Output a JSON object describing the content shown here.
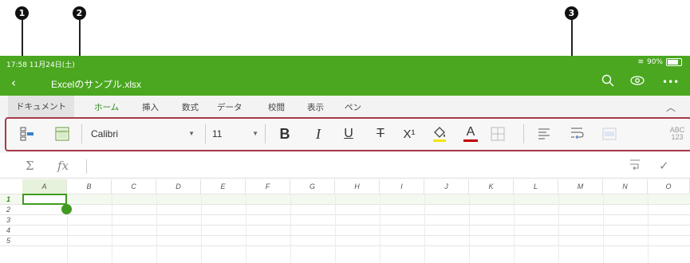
{
  "callouts": [
    "1",
    "2",
    "3"
  ],
  "statusbar": {
    "time": "17:58  11月24日(土)",
    "battery": "90%"
  },
  "titlebar": {
    "back": "‹",
    "title": "Excelのサンプル.xlsx",
    "icons": [
      "search-icon",
      "eye-icon",
      "more-icon"
    ]
  },
  "tabs": [
    "ドキュメント",
    "ホーム",
    "挿入",
    "数式",
    "データ",
    "校閲",
    "表示",
    "ペン"
  ],
  "ribbon": {
    "font": "Calibri",
    "size": "11",
    "bold": "B",
    "italic": "I",
    "underline": "U",
    "strike": "T",
    "superscript": "X¹",
    "fontcolor": "A",
    "numfmt": "ABC\n123"
  },
  "formula": {
    "sum": "Σ",
    "fx": "fx"
  },
  "grid": {
    "columns": [
      "A",
      "B",
      "C",
      "D",
      "E",
      "F",
      "G",
      "H",
      "I",
      "J",
      "K",
      "L",
      "M",
      "N",
      "O"
    ],
    "rows": [
      "1",
      "2",
      "3",
      "4",
      "5"
    ]
  },
  "colors": {
    "accent": "#4aa71f",
    "callout_box": "#a83a4a"
  }
}
